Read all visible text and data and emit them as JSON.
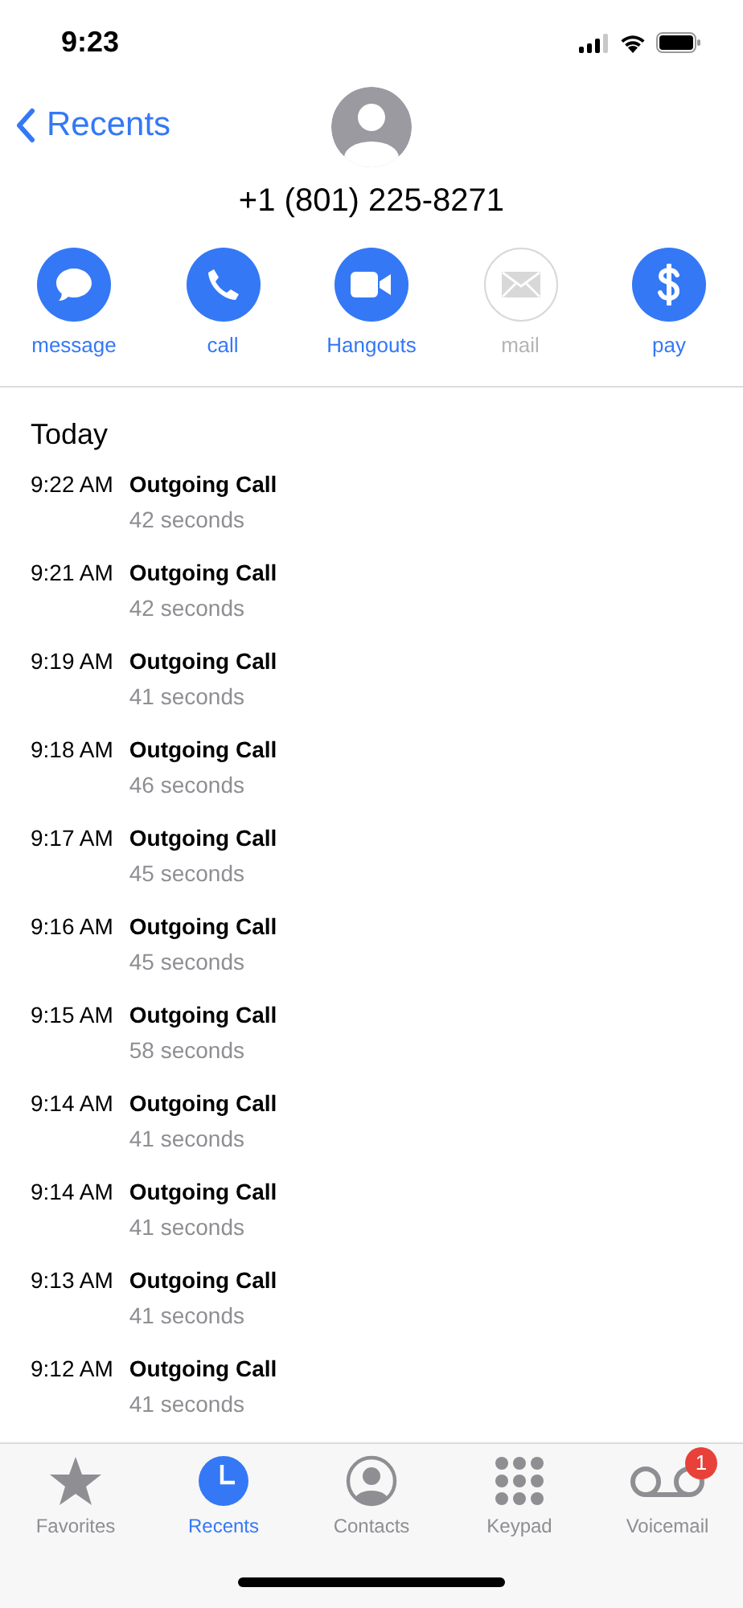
{
  "status_bar": {
    "time": "9:23"
  },
  "nav": {
    "back_label": "Recents"
  },
  "contact": {
    "phone": "+1 (801) 225-8271"
  },
  "actions": [
    {
      "kind": "message",
      "label": "message",
      "disabled": false
    },
    {
      "kind": "call",
      "label": "call",
      "disabled": false
    },
    {
      "kind": "video",
      "label": "Hangouts",
      "disabled": false
    },
    {
      "kind": "mail",
      "label": "mail",
      "disabled": true
    },
    {
      "kind": "pay",
      "label": "pay",
      "disabled": false
    }
  ],
  "section_title": "Today",
  "calls": [
    {
      "time": "9:22 AM",
      "type": "Outgoing Call",
      "duration": "42 seconds"
    },
    {
      "time": "9:21 AM",
      "type": "Outgoing Call",
      "duration": "42 seconds"
    },
    {
      "time": "9:19 AM",
      "type": "Outgoing Call",
      "duration": "41 seconds"
    },
    {
      "time": "9:18 AM",
      "type": "Outgoing Call",
      "duration": "46 seconds"
    },
    {
      "time": "9:17 AM",
      "type": "Outgoing Call",
      "duration": "45 seconds"
    },
    {
      "time": "9:16 AM",
      "type": "Outgoing Call",
      "duration": "45 seconds"
    },
    {
      "time": "9:15 AM",
      "type": "Outgoing Call",
      "duration": "58 seconds"
    },
    {
      "time": "9:14 AM",
      "type": "Outgoing Call",
      "duration": "41 seconds"
    },
    {
      "time": "9:14 AM",
      "type": "Outgoing Call",
      "duration": "41 seconds"
    },
    {
      "time": "9:13 AM",
      "type": "Outgoing Call",
      "duration": "41 seconds"
    },
    {
      "time": "9:12 AM",
      "type": "Outgoing Call",
      "duration": "41 seconds"
    }
  ],
  "tab_bar": [
    {
      "kind": "favorites",
      "label": "Favorites",
      "selected": false
    },
    {
      "kind": "recents",
      "label": "Recents",
      "selected": true
    },
    {
      "kind": "contacts",
      "label": "Contacts",
      "selected": false
    },
    {
      "kind": "keypad",
      "label": "Keypad",
      "selected": false
    },
    {
      "kind": "voicemail",
      "label": "Voicemail",
      "selected": false,
      "badge": "1"
    }
  ]
}
